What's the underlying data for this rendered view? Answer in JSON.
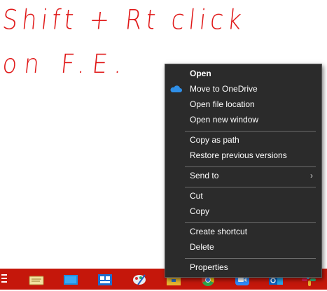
{
  "annotation": {
    "line1": "Shift + Rt click",
    "line2": "on F.E.",
    "color": "#e01818"
  },
  "context_menu": {
    "items": [
      {
        "label": "Open"
      },
      {
        "label": "Move to OneDrive",
        "icon": "onedrive-icon"
      },
      {
        "label": "Open file location"
      },
      {
        "label": "Open new window"
      },
      {
        "label": "Copy as path"
      },
      {
        "label": "Restore previous versions"
      },
      {
        "label": "Send to",
        "icon": "chevron-right-icon"
      },
      {
        "label": "Cut"
      },
      {
        "label": "Copy"
      },
      {
        "label": "Create shortcut"
      },
      {
        "label": "Delete"
      },
      {
        "label": "Properties"
      }
    ],
    "background": "#2b2b2b",
    "text_color": "#ffffff"
  },
  "taskbar": {
    "background": "#c5170b",
    "apps": [
      {
        "name": "task-view-icon"
      },
      {
        "name": "notepad-app-icon"
      },
      {
        "name": "desktop-app-icon"
      },
      {
        "name": "outlook-calendar-icon"
      },
      {
        "name": "paint-app-icon"
      },
      {
        "name": "file-explorer-icon"
      },
      {
        "name": "chrome-icon"
      },
      {
        "name": "zoom-icon"
      },
      {
        "name": "outlook-icon"
      },
      {
        "name": "slack-icon"
      }
    ]
  }
}
